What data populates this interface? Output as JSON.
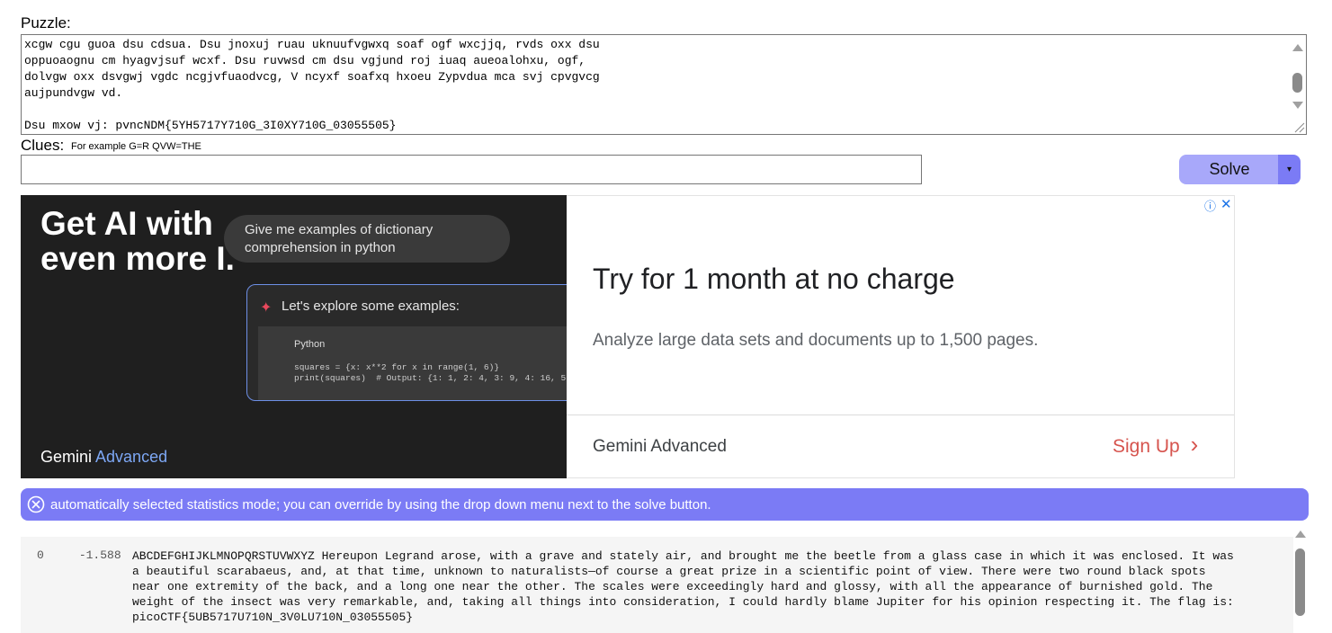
{
  "puzzle": {
    "label": "Puzzle:",
    "text": "xcgw cgu guoa dsu cdsua. Dsu jnoxuj ruau uknuufvgwxq soaf ogf wxcjjq, rvds oxx dsu\noppuoaognu cm hyagvjsuf wcxf. Dsu ruvwsd cm dsu vgjund roj iuaq aueoalohxu, ogf,\ndolvgw oxx dsvgwj vgdc ncgjvfuaodvcg, V ncyxf soafxq hxoeu Zypvdua mca svj cpvgvcg\naujpundvgw vd.\n\nDsu mxow vj: pvncNDM{5YH5717Y710G_3I0XY710G_03055505}"
  },
  "clues": {
    "label": "Clues:",
    "hint": "For example G=R QVW=THE",
    "value": ""
  },
  "solve": {
    "label": "Solve",
    "dropdown_icon": "▾"
  },
  "ad": {
    "headline": "Get AI with even more I.",
    "bubble": "Give me examples of dictionary comprehension in python",
    "explore": "Let's explore some examples:",
    "code_lang": "Python",
    "code_line1": "squares = {x: x**2 for x in range(1, 6)}",
    "code_line2": "print(squares)  # Output: {1: 1, 2: 4, 3: 9, 4: 16, 5:",
    "brand_main": "Gemini",
    "brand_accent": "Advanced",
    "title": "Try for 1 month at no charge",
    "description": "Analyze large data sets and documents up to 1,500 pages.",
    "footer_brand": "Gemini Advanced",
    "cta": "Sign Up",
    "cta_icon": "›",
    "info_icon": "ⓘ",
    "close_icon": "✕"
  },
  "notice": {
    "text": "automatically selected statistics mode; you can override by using the drop down menu next to the solve button."
  },
  "results": [
    {
      "rank": "0",
      "score": "-1.588",
      "text": "ABCDEFGHIJKLMNOPQRSTUVWXYZ Hereupon Legrand arose, with a grave and stately air, and brought me the beetle from a glass case in which it was enclosed. It was\na beautiful scarabaeus, and, at that time, unknown to naturalists—of course a great prize in a scientific point of view. There were two round black spots\nnear one extremity of the back, and a long one near the other. The scales were exceedingly hard and glossy, with all the appearance of burnished gold. The\nweight of the insect was very remarkable, and, taking all things into consideration, I could hardly blame Jupiter for his opinion respecting it. The flag is:\npicoCTF{5UB5717U710N_3V0LU710N_03055505}"
    }
  ],
  "colors": {
    "solve_button": "#a8a8fa",
    "solve_dropdown": "#7b7bf5",
    "notice_bg": "#7b7bf5",
    "ad_dark": "#1f1f1f",
    "cta": "#d6544e"
  }
}
